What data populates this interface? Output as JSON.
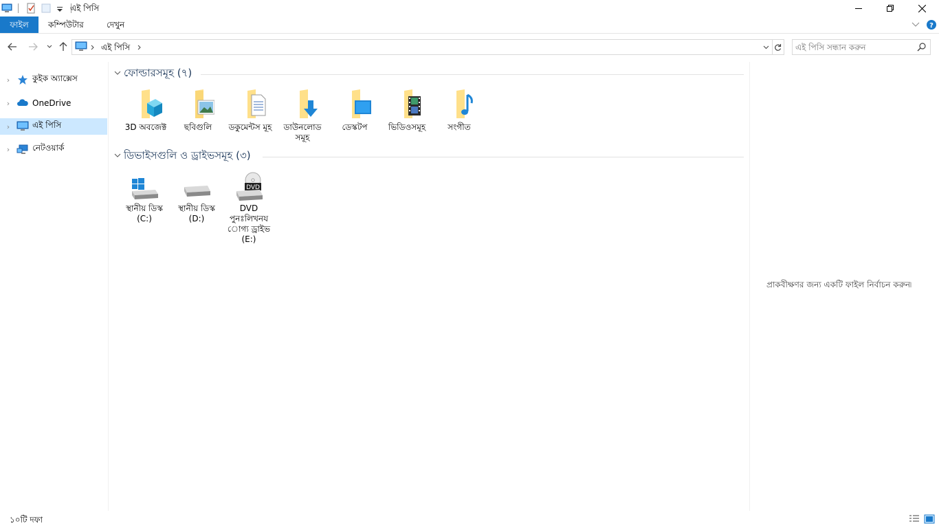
{
  "window": {
    "title": "এই পিসি",
    "minimize_icon": "minimize-icon",
    "maximize_icon": "restore-icon",
    "close_icon": "close-icon"
  },
  "ribbon": {
    "tabs": [
      {
        "label": "ফাইল"
      },
      {
        "label": "কম্পিউটার"
      },
      {
        "label": "দেখুন"
      }
    ],
    "accent": "#1979ca"
  },
  "address": {
    "path": "এই পিসি"
  },
  "search": {
    "placeholder": "এই পিসি সন্ধান করুন"
  },
  "nav": {
    "items": [
      {
        "label": "কুইক অ্যাক্সেস",
        "icon": "star-icon"
      },
      {
        "label": "OneDrive",
        "icon": "cloud-icon"
      },
      {
        "label": "এই পিসি",
        "icon": "computer-icon",
        "selected": true
      },
      {
        "label": "নেটওয়ার্ক",
        "icon": "network-icon"
      }
    ]
  },
  "groups": {
    "folders": {
      "title": "ফোল্ডারসমূহ (৭)",
      "items": [
        {
          "label": "3D অবজেক্ট",
          "icon": "3d-objects-folder-icon"
        },
        {
          "label": "ছবিগুলি",
          "icon": "pictures-folder-icon"
        },
        {
          "label": "ডকুমেন্টস মূহ",
          "icon": "documents-folder-icon"
        },
        {
          "label": "ডাউনলোড সমূহ",
          "icon": "downloads-folder-icon"
        },
        {
          "label": "ডেস্কটপ",
          "icon": "desktop-folder-icon"
        },
        {
          "label": "ভিডিওসমূহ",
          "icon": "videos-folder-icon"
        },
        {
          "label": "সংগীত",
          "icon": "music-folder-icon"
        }
      ]
    },
    "drives": {
      "title": "ডিভাইসগুলি ও ড্রাইভসমূহ (৩)",
      "items": [
        {
          "label": "স্থানীয় ডিস্ক (C:)",
          "icon": "windows-drive-icon"
        },
        {
          "label": "স্থানীয় ডিস্ক (D:)",
          "icon": "drive-icon"
        },
        {
          "label": "DVD পুনঃলিখনয োগ্য ড্রাইভ (E:)",
          "icon": "dvd-drive-icon",
          "badge": "DVD"
        }
      ]
    }
  },
  "preview": {
    "message": "প্রাকবীক্ষণর জন্য একটি ফাইল নির্বাচন করুন৷"
  },
  "status": {
    "text": "১০টি দফা"
  }
}
